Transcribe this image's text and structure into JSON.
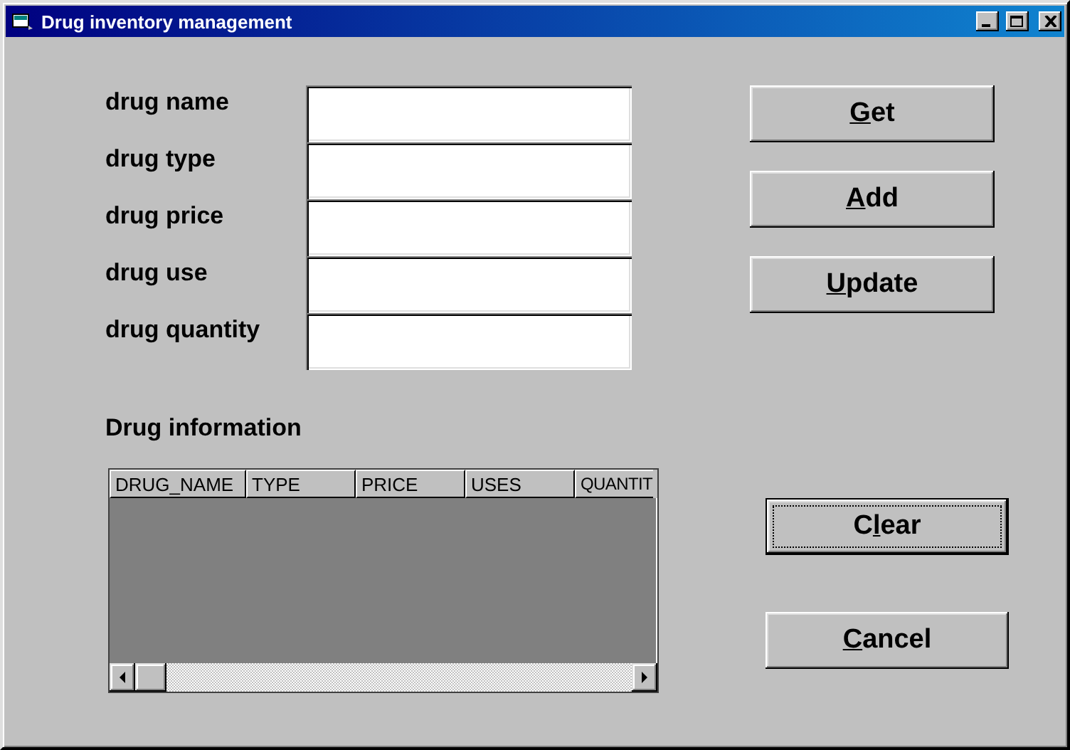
{
  "window": {
    "title": "Drug inventory management"
  },
  "fields": [
    {
      "label": "drug name"
    },
    {
      "label": "drug type"
    },
    {
      "label": "drug price"
    },
    {
      "label": "drug use"
    },
    {
      "label": "drug quantity"
    }
  ],
  "buttons": [
    {
      "key": "G",
      "after": "et",
      "focused": false
    },
    {
      "key": "A",
      "after": "dd",
      "focused": false
    },
    {
      "key": "U",
      "after": "pdate",
      "focused": false
    }
  ],
  "section_title": "Drug information",
  "grid": {
    "columns": [
      "DRUG_NAME",
      "TYPE",
      "PRICE",
      "USES",
      "QUANTIT"
    ]
  },
  "bottom_buttons": [
    {
      "before": "C",
      "key": "l",
      "after": "ear",
      "focused": true
    },
    {
      "key": "C",
      "after": "ancel",
      "focused": false
    }
  ]
}
